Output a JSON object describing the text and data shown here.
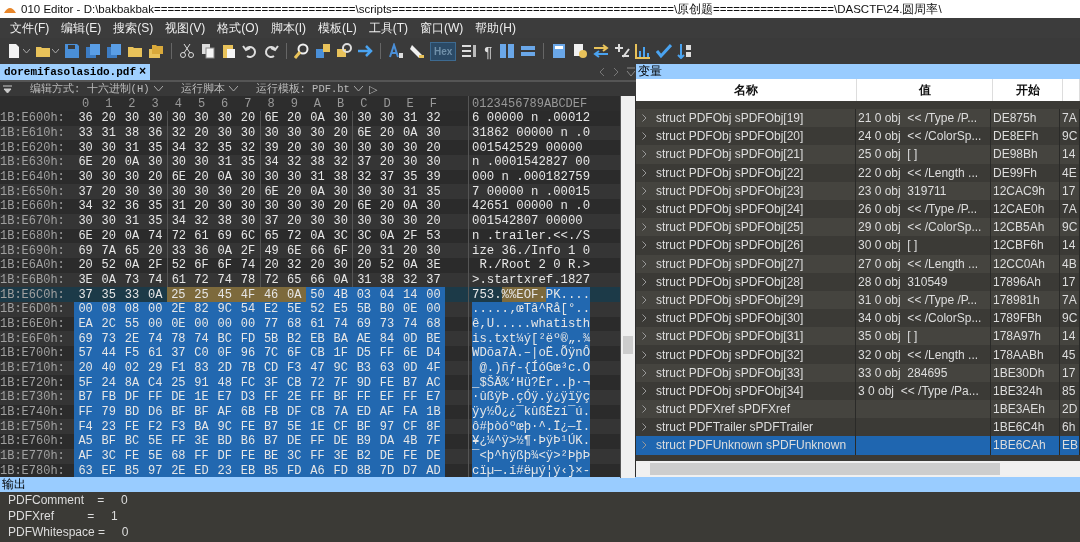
{
  "window": {
    "title": "010 Editor - D:\\bakbakbak==============================\\scripts==========================================\\原创题==================\\DASCTF\\24.圆周率\\"
  },
  "menu": [
    "文件(F)",
    "编辑(E)",
    "搜索(S)",
    "视图(V)",
    "格式(O)",
    "脚本(I)",
    "模板(L)",
    "工具(T)",
    "窗口(W)",
    "帮助(H)"
  ],
  "toolbar": {
    "hex_button": {
      "label": "Hex",
      "selected": true
    },
    "pilcrow": "¶"
  },
  "tabs": [
    {
      "label": "doremifasolasido.pdf",
      "close": "×",
      "selected": true
    }
  ],
  "edit_bar": {
    "edit_as": "编辑方式: 十六进制(H)",
    "run_script": "运行脚本",
    "run_template": "运行模板: PDF.bt",
    "play": "▷"
  },
  "hex": {
    "columns": [
      "0",
      "1",
      "2",
      "3",
      "4",
      "5",
      "6",
      "7",
      "8",
      "9",
      "A",
      "B",
      "C",
      "D",
      "E",
      "F"
    ],
    "ascii_header": "0123456789ABCDEF",
    "rows": [
      {
        "addr": "1B:E600h:",
        "current": false,
        "segments": [
          {
            "kind": "plain",
            "bytes": [
              "36",
              "20",
              "30",
              "30",
              "30",
              "30",
              "30",
              "20",
              "6E",
              "20",
              "0A",
              "30",
              "30",
              "30",
              "31",
              "32"
            ],
            "ascii": "6 00000 n .00012"
          }
        ]
      },
      {
        "addr": "1B:E610h:",
        "current": false,
        "segments": [
          {
            "kind": "plain",
            "bytes": [
              "33",
              "31",
              "38",
              "36",
              "32",
              "20",
              "30",
              "30",
              "30",
              "30",
              "30",
              "20",
              "6E",
              "20",
              "0A",
              "30"
            ],
            "ascii": "31862 00000 n .0"
          }
        ]
      },
      {
        "addr": "1B:E620h:",
        "current": false,
        "segments": [
          {
            "kind": "plain",
            "bytes": [
              "30",
              "30",
              "31",
              "35",
              "34",
              "32",
              "35",
              "32",
              "39",
              "20",
              "30",
              "30",
              "30",
              "30",
              "30",
              "20"
            ],
            "ascii": "001542529 00000"
          }
        ]
      },
      {
        "addr": "1B:E630h:",
        "current": false,
        "segments": [
          {
            "kind": "plain",
            "bytes": [
              "6E",
              "20",
              "0A",
              "30",
              "30",
              "30",
              "31",
              "35",
              "34",
              "32",
              "38",
              "32",
              "37",
              "20",
              "30",
              "30"
            ],
            "ascii": "n .0001542827 00"
          }
        ]
      },
      {
        "addr": "1B:E640h:",
        "current": false,
        "segments": [
          {
            "kind": "plain",
            "bytes": [
              "30",
              "30",
              "30",
              "20",
              "6E",
              "20",
              "0A",
              "30",
              "30",
              "30",
              "31",
              "38",
              "32",
              "37",
              "35",
              "39"
            ],
            "ascii": "000 n .000182759"
          }
        ]
      },
      {
        "addr": "1B:E650h:",
        "current": false,
        "segments": [
          {
            "kind": "plain",
            "bytes": [
              "37",
              "20",
              "30",
              "30",
              "30",
              "30",
              "30",
              "20",
              "6E",
              "20",
              "0A",
              "30",
              "30",
              "30",
              "31",
              "35"
            ],
            "ascii": "7 00000 n .00015"
          }
        ]
      },
      {
        "addr": "1B:E660h:",
        "current": false,
        "segments": [
          {
            "kind": "plain",
            "bytes": [
              "34",
              "32",
              "36",
              "35",
              "31",
              "20",
              "30",
              "30",
              "30",
              "30",
              "30",
              "20",
              "6E",
              "20",
              "0A",
              "30"
            ],
            "ascii": "42651 00000 n .0"
          }
        ]
      },
      {
        "addr": "1B:E670h:",
        "current": false,
        "segments": [
          {
            "kind": "plain",
            "bytes": [
              "30",
              "30",
              "31",
              "35",
              "34",
              "32",
              "38",
              "30",
              "37",
              "20",
              "30",
              "30",
              "30",
              "30",
              "30",
              "20"
            ],
            "ascii": "001542807 00000"
          }
        ]
      },
      {
        "addr": "1B:E680h:",
        "current": false,
        "segments": [
          {
            "kind": "plain",
            "bytes": [
              "6E",
              "20",
              "0A",
              "74",
              "72",
              "61",
              "69",
              "6C",
              "65",
              "72",
              "0A",
              "3C",
              "3C",
              "0A",
              "2F",
              "53"
            ],
            "ascii": "n .trailer.<<./S"
          }
        ]
      },
      {
        "addr": "1B:E690h:",
        "current": false,
        "segments": [
          {
            "kind": "plain",
            "bytes": [
              "69",
              "7A",
              "65",
              "20",
              "33",
              "36",
              "0A",
              "2F",
              "49",
              "6E",
              "66",
              "6F",
              "20",
              "31",
              "20",
              "30"
            ],
            "ascii": "ize 36./Info 1 0"
          }
        ]
      },
      {
        "addr": "1B:E6A0h:",
        "current": false,
        "segments": [
          {
            "kind": "plain",
            "bytes": [
              "20",
              "52",
              "0A",
              "2F",
              "52",
              "6F",
              "6F",
              "74",
              "20",
              "32",
              "20",
              "30",
              "20",
              "52",
              "0A",
              "3E"
            ],
            "ascii": " R./Root 2 0 R.>"
          }
        ]
      },
      {
        "addr": "1B:E6B0h:",
        "current": false,
        "segments": [
          {
            "kind": "plain",
            "bytes": [
              "3E",
              "0A",
              "73",
              "74",
              "61",
              "72",
              "74",
              "78",
              "72",
              "65",
              "66",
              "0A",
              "31",
              "38",
              "32",
              "37"
            ],
            "ascii": ">.startxref.1827"
          }
        ]
      },
      {
        "addr": "1B:E6C0h:",
        "current": true,
        "segments": [
          {
            "kind": "plain",
            "bytes": [
              "37",
              "35",
              "33",
              "0A"
            ],
            "ascii": "753."
          },
          {
            "kind": "found",
            "bytes": [
              "25",
              "25",
              "45",
              "4F",
              "46",
              "0A"
            ],
            "ascii": "%%EOF."
          },
          {
            "kind": "selected",
            "bytes": [
              "50",
              "4B",
              "03",
              "04",
              "14",
              "00"
            ],
            "ascii": "PK...."
          }
        ]
      },
      {
        "addr": "1B:E6D0h:",
        "current": false,
        "segments": [
          {
            "kind": "selected",
            "bytes": [
              "00",
              "08",
              "08",
              "00",
              "2E",
              "82",
              "9C",
              "54",
              "E2",
              "5E",
              "52",
              "E5",
              "5B",
              "B0",
              "0E",
              "00"
            ],
            "ascii": ".....‚œTâ^Rå[°.."
          }
        ]
      },
      {
        "addr": "1B:E6E0h:",
        "current": false,
        "segments": [
          {
            "kind": "selected",
            "bytes": [
              "EA",
              "2C",
              "55",
              "00",
              "0E",
              "00",
              "00",
              "00",
              "77",
              "68",
              "61",
              "74",
              "69",
              "73",
              "74",
              "68"
            ],
            "ascii": "ê,U.....whatisth"
          }
        ]
      },
      {
        "addr": "1B:E6F0h:",
        "current": false,
        "segments": [
          {
            "kind": "selected",
            "bytes": [
              "69",
              "73",
              "2E",
              "74",
              "78",
              "74",
              "BC",
              "FD",
              "5B",
              "B2",
              "EB",
              "BA",
              "AE",
              "84",
              "0D",
              "BE"
            ],
            "ascii": "is.txt¼ý[²ëº®„.¾"
          }
        ]
      },
      {
        "addr": "1B:E700h:",
        "current": false,
        "segments": [
          {
            "kind": "selected",
            "bytes": [
              "57",
              "44",
              "F5",
              "61",
              "37",
              "C0",
              "0F",
              "96",
              "7C",
              "6F",
              "CB",
              "1F",
              "D5",
              "FF",
              "6E",
              "D4"
            ],
            "ascii": "WDõa7À.–|oË.ÕÿnÔ"
          }
        ]
      },
      {
        "addr": "1B:E710h:",
        "current": false,
        "segments": [
          {
            "kind": "selected",
            "bytes": [
              "20",
              "40",
              "02",
              "29",
              "F1",
              "83",
              "2D",
              "7B",
              "CD",
              "F3",
              "47",
              "9C",
              "B3",
              "63",
              "0D",
              "4F"
            ],
            "ascii": " @.)ñƒ-{ÍóGœ³c.O"
          }
        ]
      },
      {
        "addr": "1B:E720h:",
        "current": false,
        "segments": [
          {
            "kind": "selected",
            "bytes": [
              "5F",
              "24",
              "8A",
              "C4",
              "25",
              "91",
              "48",
              "FC",
              "3F",
              "CB",
              "72",
              "7F",
              "9D",
              "FE",
              "B7",
              "AC"
            ],
            "ascii": "_$ŠÄ%‘Hü?Ër..þ·¬"
          }
        ]
      },
      {
        "addr": "1B:E730h:",
        "current": false,
        "segments": [
          {
            "kind": "selected",
            "bytes": [
              "B7",
              "FB",
              "DF",
              "FF",
              "DE",
              "1E",
              "E7",
              "D3",
              "FF",
              "2E",
              "FF",
              "BF",
              "FF",
              "EF",
              "FF",
              "E7"
            ],
            "ascii": "·ûßÿÞ.çÓÿ.ÿ¿ÿïÿç"
          }
        ]
      },
      {
        "addr": "1B:E740h:",
        "current": false,
        "segments": [
          {
            "kind": "selected",
            "bytes": [
              "FF",
              "79",
              "BD",
              "D6",
              "BF",
              "BF",
              "AF",
              "6B",
              "FB",
              "DF",
              "CB",
              "7A",
              "ED",
              "AF",
              "FA",
              "1B"
            ],
            "ascii": "ÿy½Ö¿¿¯kûßËzí¯ú."
          }
        ]
      },
      {
        "addr": "1B:E750h:",
        "current": false,
        "segments": [
          {
            "kind": "selected",
            "bytes": [
              "F4",
              "23",
              "FE",
              "F2",
              "F3",
              "BA",
              "9C",
              "FE",
              "B7",
              "5E",
              "1E",
              "CF",
              "BF",
              "97",
              "CF",
              "8F"
            ],
            "ascii": "ô#þòóºœþ·^.Ï¿—Ï."
          }
        ]
      },
      {
        "addr": "1B:E760h:",
        "current": false,
        "segments": [
          {
            "kind": "selected",
            "bytes": [
              "A5",
              "BF",
              "BC",
              "5E",
              "FF",
              "3E",
              "BD",
              "B6",
              "B7",
              "DE",
              "FF",
              "DE",
              "B9",
              "DA",
              "4B",
              "7F"
            ],
            "ascii": "¥¿¼^ÿ>½¶·ÞÿÞ¹ÚK."
          }
        ]
      },
      {
        "addr": "1B:E770h:",
        "current": false,
        "segments": [
          {
            "kind": "selected",
            "bytes": [
              "AF",
              "3C",
              "FE",
              "5E",
              "68",
              "FF",
              "DF",
              "FE",
              "BE",
              "3C",
              "FF",
              "3E",
              "B2",
              "DE",
              "FE",
              "DE"
            ],
            "ascii": "¯<þ^hÿßþ¾<ÿ>²ÞþÞ"
          }
        ]
      },
      {
        "addr": "1B:E780h:",
        "current": false,
        "segments": [
          {
            "kind": "selected",
            "bytes": [
              "63",
              "EF",
              "B5",
              "97",
              "2E",
              "ED",
              "23",
              "EB",
              "B5",
              "FD",
              "A6",
              "FD",
              "8B",
              "7D",
              "D7",
              "AD"
            ],
            "ascii": "cïµ—.í#ëµý¦ý‹}×-"
          }
        ]
      }
    ]
  },
  "variables": {
    "title": "变量",
    "columns": [
      "名称",
      "值",
      "开始"
    ],
    "rows": [
      {
        "name": "struct PDFObj sPDFObj[19]",
        "value": "21 0 obj  << /Type /P...",
        "start": "DE875h",
        "column_4": "7A",
        "selected": false
      },
      {
        "name": "struct PDFObj sPDFObj[20]",
        "value": "24 0 obj  << /ColorSp...",
        "start": "DE8EFh",
        "column_4": "9C",
        "selected": false
      },
      {
        "name": "struct PDFObj sPDFObj[21]",
        "value": "25 0 obj  [ ]",
        "start": "DE98Bh",
        "column_4": "14",
        "selected": false
      },
      {
        "name": "struct PDFObj sPDFObj[22]",
        "value": "22 0 obj  << /Length ...",
        "start": "DE99Fh",
        "column_4": "4E",
        "selected": false
      },
      {
        "name": "struct PDFObj sPDFObj[23]",
        "value": "23 0 obj  319711",
        "start": "12CAC9h",
        "column_4": "17",
        "selected": false
      },
      {
        "name": "struct PDFObj sPDFObj[24]",
        "value": "26 0 obj  << /Type /P...",
        "start": "12CAE0h",
        "column_4": "7A",
        "selected": false
      },
      {
        "name": "struct PDFObj sPDFObj[25]",
        "value": "29 0 obj  << /ColorSp...",
        "start": "12CB5Ah",
        "column_4": "9C",
        "selected": false
      },
      {
        "name": "struct PDFObj sPDFObj[26]",
        "value": "30 0 obj  [ ]",
        "start": "12CBF6h",
        "column_4": "14",
        "selected": false
      },
      {
        "name": "struct PDFObj sPDFObj[27]",
        "value": "27 0 obj  << /Length ...",
        "start": "12CC0Ah",
        "column_4": "4B",
        "selected": false
      },
      {
        "name": "struct PDFObj sPDFObj[28]",
        "value": "28 0 obj  310549",
        "start": "17896Ah",
        "column_4": "17",
        "selected": false
      },
      {
        "name": "struct PDFObj sPDFObj[29]",
        "value": "31 0 obj  << /Type /P...",
        "start": "178981h",
        "column_4": "7A",
        "selected": false
      },
      {
        "name": "struct PDFObj sPDFObj[30]",
        "value": "34 0 obj  << /ColorSp...",
        "start": "1789FBh",
        "column_4": "9C",
        "selected": false
      },
      {
        "name": "struct PDFObj sPDFObj[31]",
        "value": "35 0 obj  [ ]",
        "start": "178A97h",
        "column_4": "14",
        "selected": false
      },
      {
        "name": "struct PDFObj sPDFObj[32]",
        "value": "32 0 obj  << /Length ...",
        "start": "178AABh",
        "column_4": "45",
        "selected": false
      },
      {
        "name": "struct PDFObj sPDFObj[33]",
        "value": "33 0 obj  284695",
        "start": "1BE30Dh",
        "column_4": "17",
        "selected": false
      },
      {
        "name": "struct PDFObj sPDFObj[34]",
        "value": "3 0 obj  << /Type /Pa...",
        "start": "1BE324h",
        "column_4": "85",
        "selected": false
      },
      {
        "name": "struct PDFXref sPDFXref",
        "value": "",
        "start": "1BE3AEh",
        "column_4": "2D",
        "selected": false
      },
      {
        "name": "struct PDFTrailer sPDFTrailer",
        "value": "",
        "start": "1BE6C4h",
        "column_4": "6h",
        "selected": false
      },
      {
        "name": "struct PDFUnknown sPDFUnknown",
        "value": "",
        "start": "1BE6CAh",
        "column_4": "EB",
        "selected": true
      }
    ]
  },
  "output": {
    "title": "输出",
    "lines": [
      "PDFComment    =     0",
      "PDFXref          =     1",
      "PDFWhitespace =     0"
    ]
  }
}
